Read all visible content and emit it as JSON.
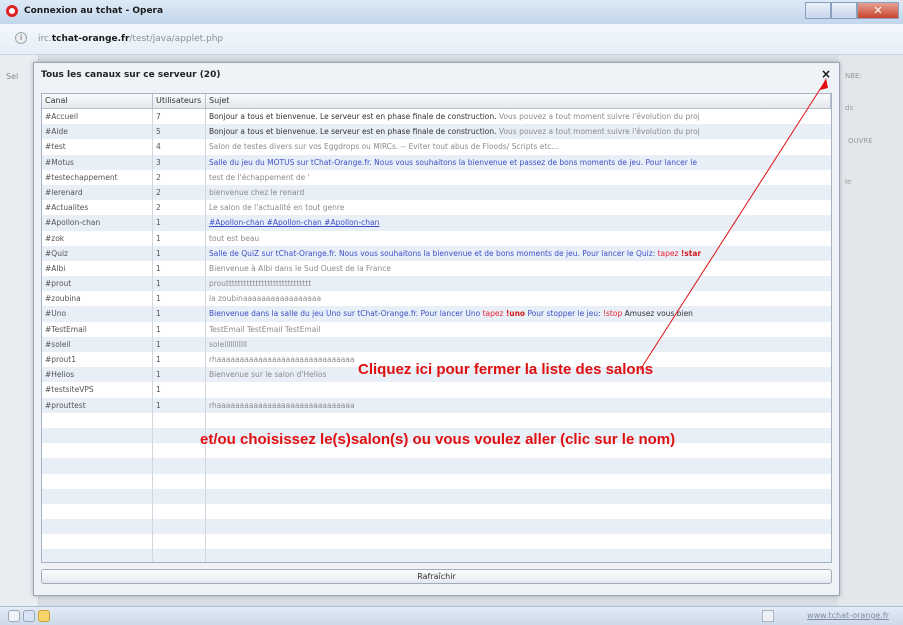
{
  "window": {
    "title": "Connexion au tchat - Opera",
    "url_prefix": "irc.",
    "url_domain": "tchat-orange.fr",
    "url_path": "/test/java/applet.php"
  },
  "page": {
    "left_label": "Sel",
    "right_labels": [
      "NBE:",
      "ds",
      "OUVRE",
      "le"
    ],
    "status_right": "www.tchat-orange.fr"
  },
  "dialog": {
    "title": "Tous les canaux sur ce serveur  (20)",
    "close": "×",
    "columns": [
      "Canal",
      "Utilisateurs",
      "Sujet"
    ],
    "refresh_label": "Rafraîchir"
  },
  "rows": [
    {
      "canal": "#Accueil",
      "users": "7",
      "sujet": "Bonjour a tous et bienvenue. Le serveur est en phase finale de construction.",
      "sujet_extra": " Vous pouvez a tout moment suivre l'évolution du proj"
    },
    {
      "canal": "#Aide",
      "users": "5",
      "sujet": "Bonjour a tous et bienvenue. Le serveur est en phase finale de construction.",
      "sujet_extra": " Vous pouvez a tout moment suivre l'évolution du proj"
    },
    {
      "canal": "#test",
      "users": "4",
      "sujet": "Salon de testes divers sur vos Eggdrops ou MIRCs. -- Eviter tout abus de Floods/ Scripts etc..."
    },
    {
      "canal": "#Motus",
      "users": "3",
      "sujet": "Salle du jeu du MOTUS sur tChat-Orange.fr. Nous vous souhaitons la bienvenue et passez de bons moments de jeu. Pour lancer le"
    },
    {
      "canal": "#testechappement",
      "users": "2",
      "sujet": "test de l'échappement de '"
    },
    {
      "canal": "#lerenard",
      "users": "2",
      "sujet": "bienvenue chez le renard"
    },
    {
      "canal": "#Actualites",
      "users": "2",
      "sujet": "Le salon de l'actualité en tout genre"
    },
    {
      "canal": "#Apollon-chan",
      "users": "1",
      "sujet": "#Apollon-chan #Apollon-chan #Apollon-chan"
    },
    {
      "canal": "#zok",
      "users": "1",
      "sujet": "tout est beau"
    },
    {
      "canal": "#Quiz",
      "users": "1",
      "sujet": "Salle de QuiZ sur tChat-Orange.fr. Nous vous souhaitons la bienvenue et de bons moments de jeu. Pour lancer le Quiz: ",
      "sujet_red": " tapez ",
      "sujet_red_bold": "!star"
    },
    {
      "canal": "#Albi",
      "users": "1",
      "sujet": "Bienvenue à Albi dans le Sud Ouest de la France"
    },
    {
      "canal": "#prout",
      "users": "1",
      "sujet": "prouttttttttttttttttttttttttttttt"
    },
    {
      "canal": "#zoubina",
      "users": "1",
      "sujet": "la zoubinaaaaaaaaaaaaaaaaa"
    },
    {
      "canal": "#Uno",
      "users": "1",
      "sujet": "Bienvenue dans la salle du jeu Uno sur tChat-Orange.fr. Pour lancer Uno ",
      "sujet_red": " tapez ",
      "sujet_red_bold": "!uno",
      "sujet_after": " Pour stopper le jeu: ",
      "sujet_red2": "!stop",
      "sujet_tail": "  Amusez vous bien"
    },
    {
      "canal": "#TestEmail",
      "users": "1",
      "sujet": "TestEmail TestEmail TestEmail"
    },
    {
      "canal": "#soleil",
      "users": "1",
      "sujet": "soleillllllllll"
    },
    {
      "canal": "#prout1",
      "users": "1",
      "sujet": "rhaaaaaaaaaaaaaaaaaaaaaaaaaaaaaa"
    },
    {
      "canal": "#Helios",
      "users": "1",
      "sujet": "Bienvenue sur le salon d'Helios"
    },
    {
      "canal": "#testsiteVPS",
      "users": "1",
      "sujet": ""
    },
    {
      "canal": "#prouttest",
      "users": "1",
      "sujet": "rhaaaaaaaaaaaaaaaaaaaaaaaaaaaaaa"
    }
  ],
  "annotations": {
    "close_hint": "Cliquez ici pour fermer la liste des salons",
    "choose_hint": "et/ou choisissez le(s)salon(s) ou vous voulez aller  (clic sur le nom)"
  },
  "colors": {
    "annotation_red": "#e01010",
    "link_blue": "#3d50c8"
  }
}
